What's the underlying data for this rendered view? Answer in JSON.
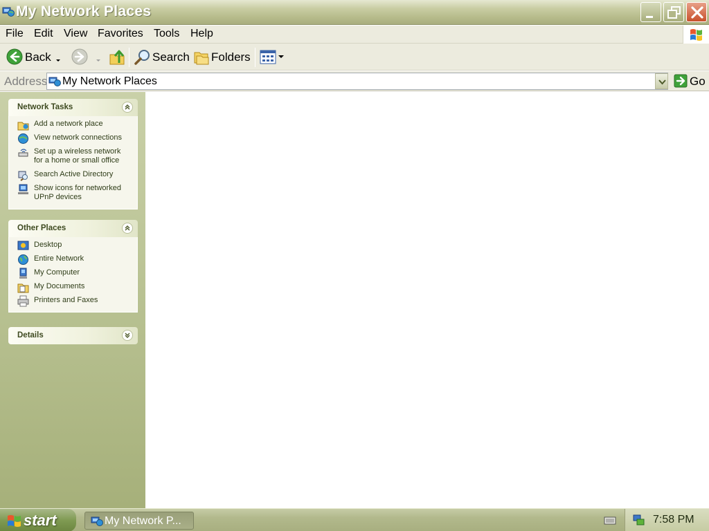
{
  "window": {
    "title": "My Network Places"
  },
  "menu": [
    "File",
    "Edit",
    "View",
    "Favorites",
    "Tools",
    "Help"
  ],
  "toolbar": {
    "back_label": "Back",
    "search_label": "Search",
    "folders_label": "Folders"
  },
  "address": {
    "label": "Address",
    "value": "My Network Places",
    "go_label": "Go"
  },
  "network_tasks": {
    "title": "Network Tasks",
    "items": [
      {
        "line1": "Add a network place",
        "line2": "",
        "icon": "add-network-place-icon"
      },
      {
        "line1": "View network connections",
        "line2": "",
        "icon": "network-connections-icon"
      },
      {
        "line1": "Set up a wireless network",
        "line2": "for a home or small office",
        "icon": "wireless-setup-icon"
      },
      {
        "line1": "Search Active Directory",
        "line2": "",
        "icon": "active-directory-icon"
      },
      {
        "line1": "Show icons for networked",
        "line2": "UPnP devices",
        "icon": "upnp-devices-icon"
      }
    ]
  },
  "other_places": {
    "title": "Other Places",
    "items": [
      {
        "label": "Desktop",
        "icon": "desktop-icon"
      },
      {
        "label": "Entire Network",
        "icon": "globe-icon"
      },
      {
        "label": "My Computer",
        "icon": "computer-icon"
      },
      {
        "label": "My Documents",
        "icon": "documents-folder-icon"
      },
      {
        "label": "Printers and Faxes",
        "icon": "printer-icon"
      }
    ]
  },
  "details": {
    "title": "Details"
  },
  "taskbar": {
    "start_label": "start",
    "task_button_label": "My Network P...",
    "clock": "7:58 PM"
  },
  "colors": {
    "title_bar": "#b7bc8c",
    "task_pane": "#bcc597",
    "panel_title": "#3e4a20",
    "start_button": "#7f9a52"
  }
}
